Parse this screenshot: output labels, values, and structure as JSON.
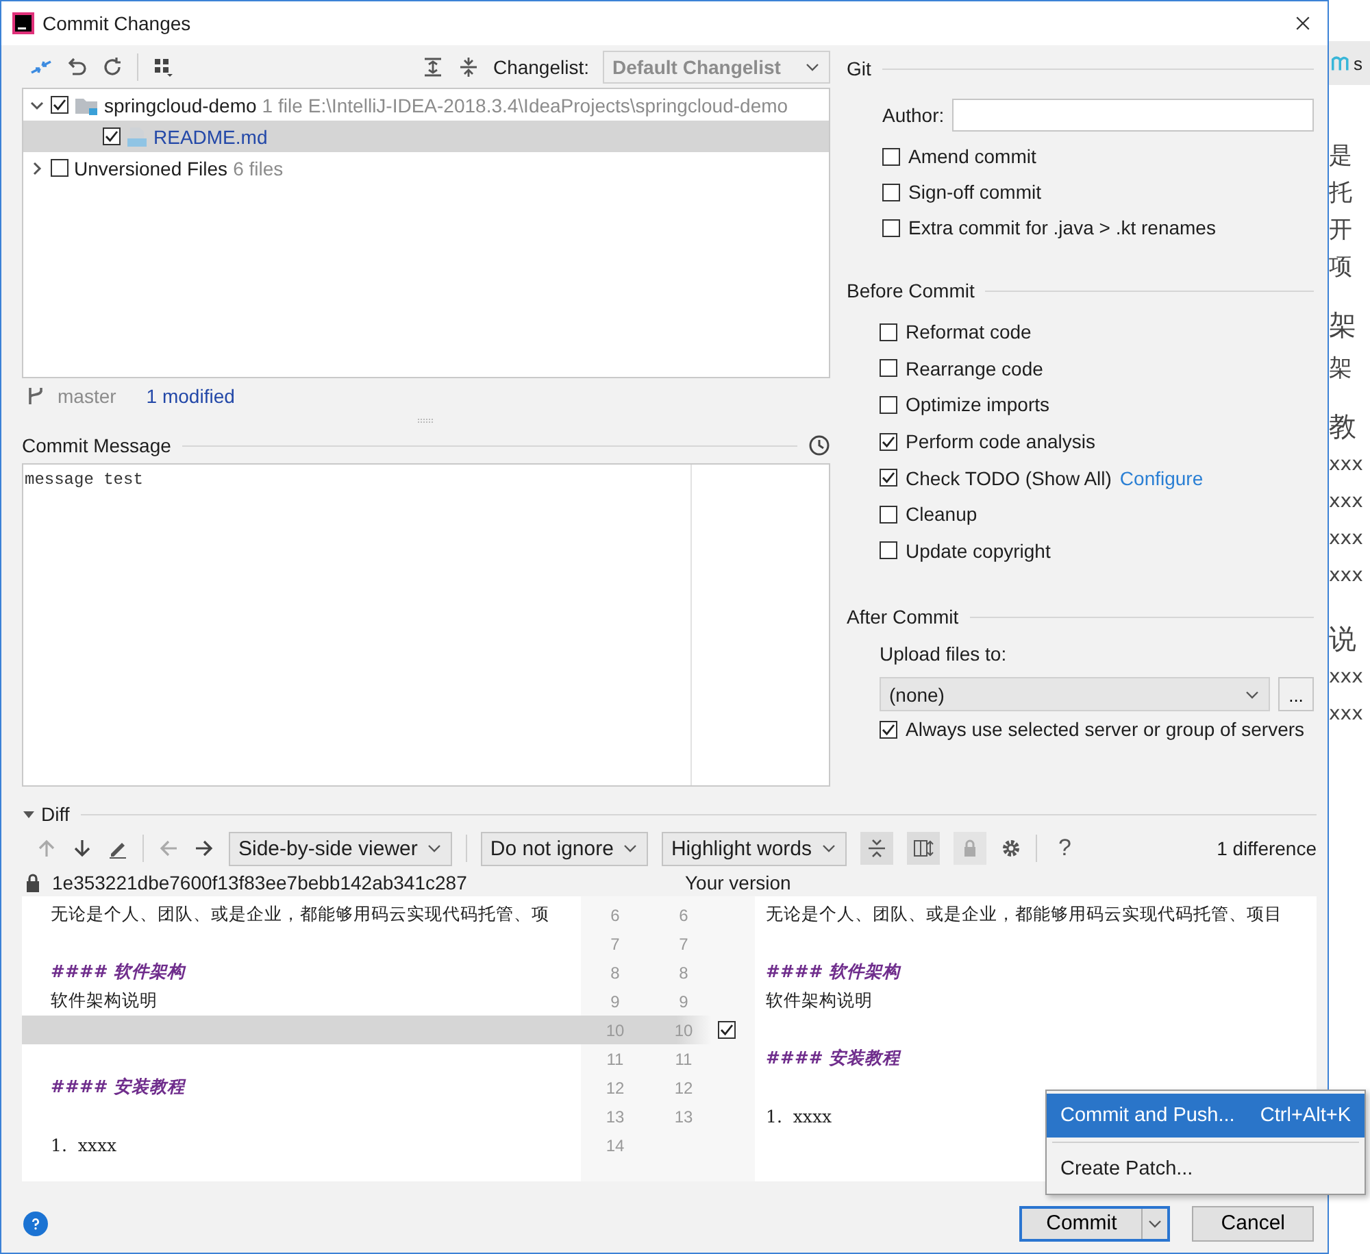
{
  "window": {
    "title": "Commit Changes"
  },
  "changelist": {
    "label": "Changelist:",
    "value": "Default Changelist"
  },
  "tree": [
    {
      "kind": "folder",
      "name": "springcloud-demo",
      "count": "1 file",
      "path": "E:\\IntelliJ-IDEA-2018.3.4\\IdeaProjects\\springcloud-demo",
      "expanded": true,
      "checked": true,
      "selected": false,
      "children": [
        {
          "kind": "file",
          "name": "README.md",
          "checked": true,
          "selected": true
        }
      ]
    },
    {
      "kind": "group",
      "name": "Unversioned Files",
      "count": "6 files",
      "expanded": false,
      "checked": false,
      "selected": false
    }
  ],
  "status": {
    "branch": "master",
    "changes": "1 modified"
  },
  "commit_message": {
    "label": "Commit Message",
    "value": "message test"
  },
  "git": {
    "title": "Git",
    "author_label": "Author:",
    "options": [
      {
        "label": "Amend commit",
        "checked": false
      },
      {
        "label": "Sign-off commit",
        "checked": false
      },
      {
        "label": "Extra commit for .java > .kt renames",
        "checked": false
      }
    ]
  },
  "before_commit": {
    "title": "Before Commit",
    "options": [
      {
        "label": "Reformat code",
        "checked": false
      },
      {
        "label": "Rearrange code",
        "checked": false
      },
      {
        "label": "Optimize imports",
        "checked": false
      },
      {
        "label": "Perform code analysis",
        "checked": true
      },
      {
        "label": "Check TODO (Show All)",
        "checked": true,
        "link": "Configure"
      },
      {
        "label": "Cleanup",
        "checked": false
      },
      {
        "label": "Update copyright",
        "checked": false
      }
    ]
  },
  "after_commit": {
    "title": "After Commit",
    "upload_label": "Upload files to:",
    "upload_value": "(none)",
    "browse": "...",
    "options": [
      {
        "label": "Always use selected server or group of servers",
        "checked": true
      }
    ]
  },
  "diff": {
    "title": "Diff",
    "expanded": true,
    "viewer": "Side-by-side viewer",
    "ignore": "Do not ignore",
    "highlight": "Highlight words",
    "help": "?",
    "count": "1 difference",
    "left_title": "1e353221dbe7600f13f83ee7bebb142ab341c287",
    "right_title": "Your version",
    "rows": [
      {
        "left": {
          "no": "6",
          "kind": "text",
          "text": "无论是个人、团队、或是企业，都能够用码云实现代码托管、项"
        },
        "right": {
          "no": "6",
          "kind": "text",
          "text": "无论是个人、团队、或是企业，都能够用码云实现代码托管、项目"
        }
      },
      {
        "left": {
          "no": "7",
          "kind": "blank"
        },
        "right": {
          "no": "7",
          "kind": "blank"
        }
      },
      {
        "left": {
          "no": "8",
          "kind": "heading",
          "text": "#### 软件架构"
        },
        "right": {
          "no": "8",
          "kind": "heading",
          "text": "#### 软件架构"
        }
      },
      {
        "left": {
          "no": "9",
          "kind": "text",
          "text": "软件架构说明"
        },
        "right": {
          "no": "9",
          "kind": "text",
          "text": "软件架构说明"
        }
      },
      {
        "left": {
          "no": "10",
          "kind": "deleted"
        },
        "right": {
          "no": "10",
          "kind": "blank"
        },
        "checked": true
      },
      {
        "left": {
          "no": "11",
          "kind": "blank"
        },
        "right": {
          "no": "11",
          "kind": "heading",
          "text": "#### 安装教程"
        }
      },
      {
        "left": {
          "no": "12",
          "kind": "heading",
          "text": "#### 安装教程"
        },
        "right": {
          "no": "12",
          "kind": "blank"
        }
      },
      {
        "left": {
          "no": "13",
          "kind": "blank"
        },
        "right": {
          "no": "13",
          "kind": "list",
          "text": "1.  xxxx"
        }
      },
      {
        "left": {
          "no": "14",
          "kind": "list",
          "text": "1.  xxxx"
        }
      }
    ]
  },
  "menu": [
    {
      "label": "Commit and Push...",
      "shortcut": "Ctrl+Alt+K",
      "selected": true
    },
    {
      "label": "Create Patch...",
      "selected": false
    }
  ],
  "buttons": {
    "commit": "Commit",
    "cancel": "Cancel"
  },
  "background_window": {
    "tab": "s",
    "lines": [
      {
        "kind": "cjk",
        "text": "是"
      },
      {
        "kind": "cjk",
        "text": "托"
      },
      {
        "kind": "cjk",
        "text": "开"
      },
      {
        "kind": "cjk",
        "text": "项"
      },
      {
        "kind": "cjk-big",
        "text": "架"
      },
      {
        "kind": "cjk",
        "text": "架"
      },
      {
        "kind": "cjk-big",
        "text": "教"
      },
      {
        "kind": "latin",
        "text": "xxx"
      },
      {
        "kind": "latin",
        "text": "xxx"
      },
      {
        "kind": "latin",
        "text": "xxx"
      },
      {
        "kind": "latin",
        "text": "xxx"
      },
      {
        "kind": "cjk-big",
        "text": "说"
      },
      {
        "kind": "latin",
        "text": "xxx"
      },
      {
        "kind": "latin",
        "text": "xxx"
      }
    ]
  }
}
